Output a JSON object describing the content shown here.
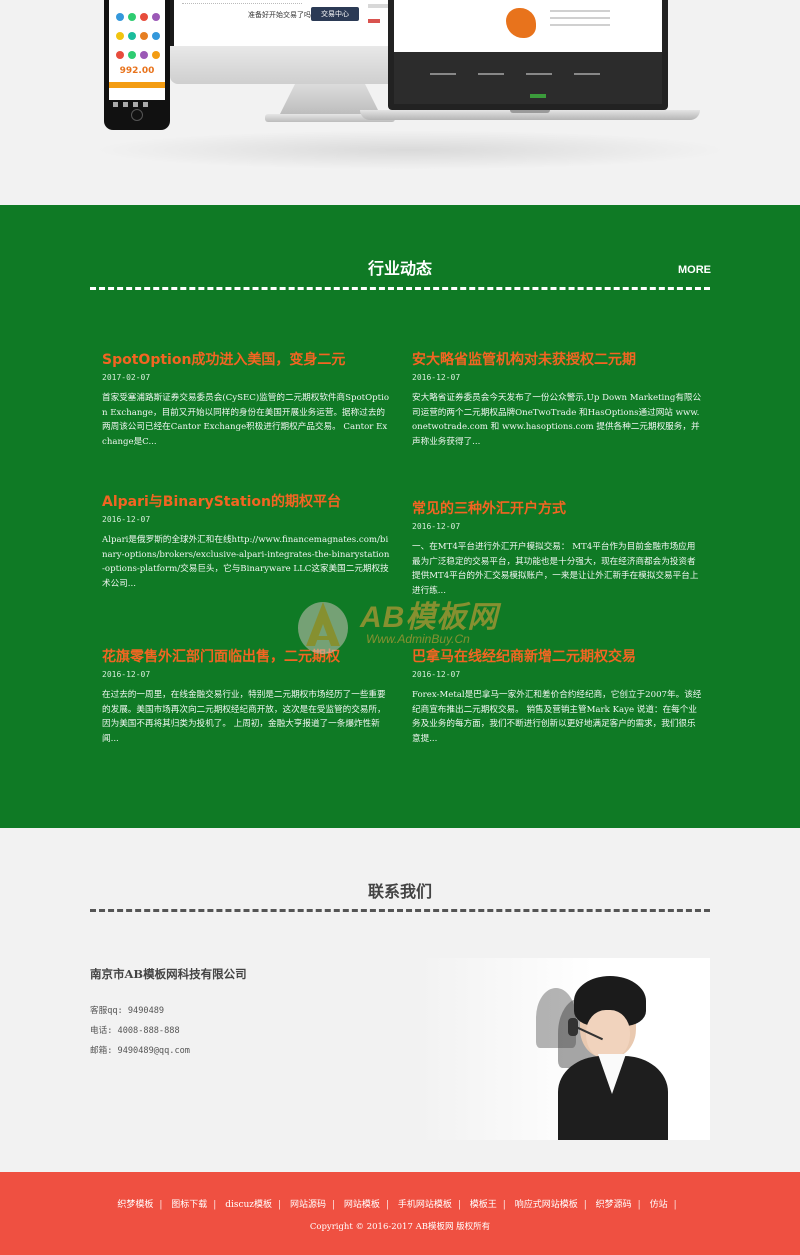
{
  "devices": {
    "monitor_prompt": "准备好开始交易了吗？",
    "monitor_button": "交易中心",
    "phone_price": "992.00"
  },
  "news": {
    "title": "行业动态",
    "more": "MORE",
    "items": [
      {
        "title": "SpotOption成功进入美国，变身二元",
        "date": "2017-02-07",
        "summary": "首家受塞浦路斯证券交易委员会(CySEC)监管的二元期权软件商SpotOption Exchange，目前又开始以同样的身份在美国开展业务运营。据称过去的两周该公司已经在Cantor Exchange积极进行期权产品交易。 Cantor Exchange是C..."
      },
      {
        "title": "安大略省监管机构对未获授权二元期",
        "date": "2016-12-07",
        "summary": "安大略省证券委员会今天发布了一份公众警示,Up Down Marketing有限公司运营的两个二元期权品牌OneTwoTrade 和HasOptions通过网站 www.onetwotrade.com 和 www.hasoptions.com 提供各种二元期权服务，并声称业务获得了..."
      },
      {
        "title": "Alpari与BinaryStation的期权平台",
        "date": "2016-12-07",
        "summary": "Alpari是俄罗斯的全球外汇和在线http://www.financemagnates.com/binary-options/brokers/exclusive-alpari-integrates-the-binarystation-options-platform/交易巨头，它与Binaryware LLC这家美国二元期权技术公司..."
      },
      {
        "title": "常见的三种外汇开户方式",
        "date": "2016-12-07",
        "summary": "一、在MT4平台进行外汇开户模拟交易： MT4平台作为目前金融市场应用最为广泛稳定的交易平台，其功能也是十分强大，现在经济商都会为投资者提供MT4平台的外汇交易模拟账户，一来是让让外汇新手在模拟交易平台上进行练..."
      },
      {
        "title": "花旗零售外汇部门面临出售，二元期权",
        "date": "2016-12-07",
        "summary": "在过去的一周里，在线金融交易行业，特别是二元期权市场经历了一些重要的发展。美国市场再次向二元期权经纪商开放，这次是在受监管的交易所，因为美国不再将其归类为投机了。 上周初，金融大亨报道了一条爆炸性新闻..."
      },
      {
        "title": "巴拿马在线经纪商新增二元期权交易",
        "date": "2016-12-07",
        "summary": "Forex-Metal是巴拿马一家外汇和差价合约经纪商，它创立于2007年。该经纪商宣布推出二元期权交易。 销售及营销主管Mark Kaye 说道：在每个业务及业务的每方面，我们不断进行创新以更好地满足客户的需求，我们很乐意提..."
      }
    ]
  },
  "watermark": {
    "big": "AB模板网",
    "small": "Www.AdminBuy.Cn"
  },
  "contact": {
    "title": "联系我们",
    "company": "南京市AB模板网科技有限公司",
    "qq": "客服qq: 9490489",
    "phone": "电话: 4008-888-888",
    "email": "邮箱: 9490489@qq.com"
  },
  "footer": {
    "links": [
      "织梦模板",
      "图标下载",
      "discuz模板",
      "网站源码",
      "网站模板",
      "手机网站模板",
      "模板王",
      "响应式网站模板",
      "织梦源码",
      "仿站"
    ],
    "copyright": "Copyright © 2016-2017 AB模板网 版权所有"
  }
}
